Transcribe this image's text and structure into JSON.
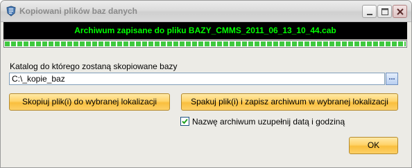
{
  "window": {
    "title": "Kopiowani plików baz danych"
  },
  "status": {
    "message": "Archiwum zapisane do pliku BAZY_CMMS_2011_06_13_10_44.cab",
    "progress_fraction": 1.0,
    "text_color": "#00ff00",
    "background_color": "#000000",
    "progress_color": "#3fc93f"
  },
  "catalog": {
    "label": "Katalog do którego zostaną skopiowane bazy",
    "path_value": "C:\\_kopie_baz",
    "browse_label": "..."
  },
  "buttons": {
    "copy_label": "Skopiuj plik(i) do wybranej lokalizacji",
    "pack_label": "Spakuj plik(i) i zapisz archiwum w wybranej lokalizacji",
    "ok_label": "OK",
    "accent_color": "#ffd36a"
  },
  "options": {
    "append_date_label": "Nazwę archiwum uzupełnij datą i godziną",
    "append_date_checked": true
  },
  "icons": {
    "app": "app-icon",
    "minimize": "minimize-icon",
    "maximize": "maximize-icon",
    "close": "close-icon",
    "checkmark": "checkmark-icon"
  }
}
